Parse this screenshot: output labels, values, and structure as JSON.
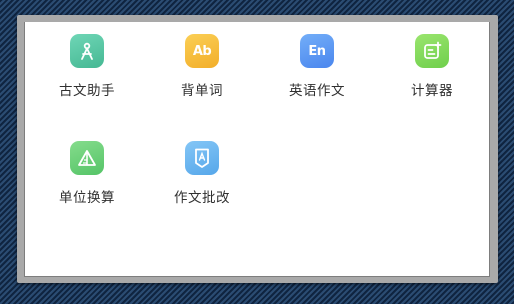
{
  "apps": [
    {
      "label": "古文助手",
      "icon": "compass-icon",
      "color": "#5cc8a8"
    },
    {
      "label": "背单词",
      "icon": "ab-letters-icon",
      "glyph": "Ab",
      "color": "#f7bf3f"
    },
    {
      "label": "英语作文",
      "icon": "en-letters-icon",
      "glyph": "En",
      "color": "#5d9cf5"
    },
    {
      "label": "计算器",
      "icon": "calculator-icon",
      "color": "#87dc5c"
    },
    {
      "label": "单位换算",
      "icon": "ruler-triangle-icon",
      "color": "#6fd27a"
    },
    {
      "label": "作文批改",
      "icon": "essay-check-icon",
      "color": "#6bb7f0"
    }
  ]
}
